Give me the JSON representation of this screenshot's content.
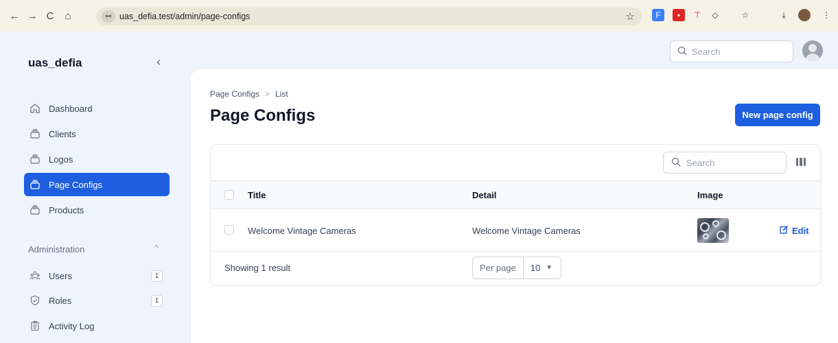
{
  "browser": {
    "url": "uas_defia.test/admin/page-configs",
    "back": "←",
    "forward": "→",
    "reload": "C",
    "home": "⌂",
    "site_icon": "⚯",
    "star": "☆"
  },
  "sidebar": {
    "brand": "uas_defia",
    "collapse": "‹",
    "items": [
      {
        "label": "Dashboard",
        "icon": "home-icon"
      },
      {
        "label": "Clients",
        "icon": "stack-icon"
      },
      {
        "label": "Logos",
        "icon": "stack-icon"
      },
      {
        "label": "Page Configs",
        "icon": "stack-icon",
        "active": true
      },
      {
        "label": "Products",
        "icon": "stack-icon"
      }
    ],
    "group": {
      "label": "Administration",
      "caret": "^",
      "items": [
        {
          "label": "Users",
          "icon": "users-icon",
          "badge": "1"
        },
        {
          "label": "Roles",
          "icon": "shield-check-icon",
          "badge": "1"
        },
        {
          "label": "Activity Log",
          "icon": "clipboard-icon"
        }
      ]
    }
  },
  "topbar": {
    "search_placeholder": "Search"
  },
  "main": {
    "breadcrumb": [
      "Page Configs",
      ">",
      "List"
    ],
    "title": "Page Configs",
    "new_button": "New page config",
    "table": {
      "search_placeholder": "Search",
      "columns": [
        "Title",
        "Detail",
        "Image"
      ],
      "rows": [
        {
          "title": "Welcome Vintage Cameras",
          "detail": "Welcome Vintage Cameras",
          "image": "cameras-thumbnail",
          "action": "Edit"
        }
      ],
      "footer": "Showing 1 result",
      "per_page_label": "Per page",
      "per_page_value": "10"
    }
  },
  "colors": {
    "accent": "#1e5ee0",
    "background": "#eef4fc"
  }
}
